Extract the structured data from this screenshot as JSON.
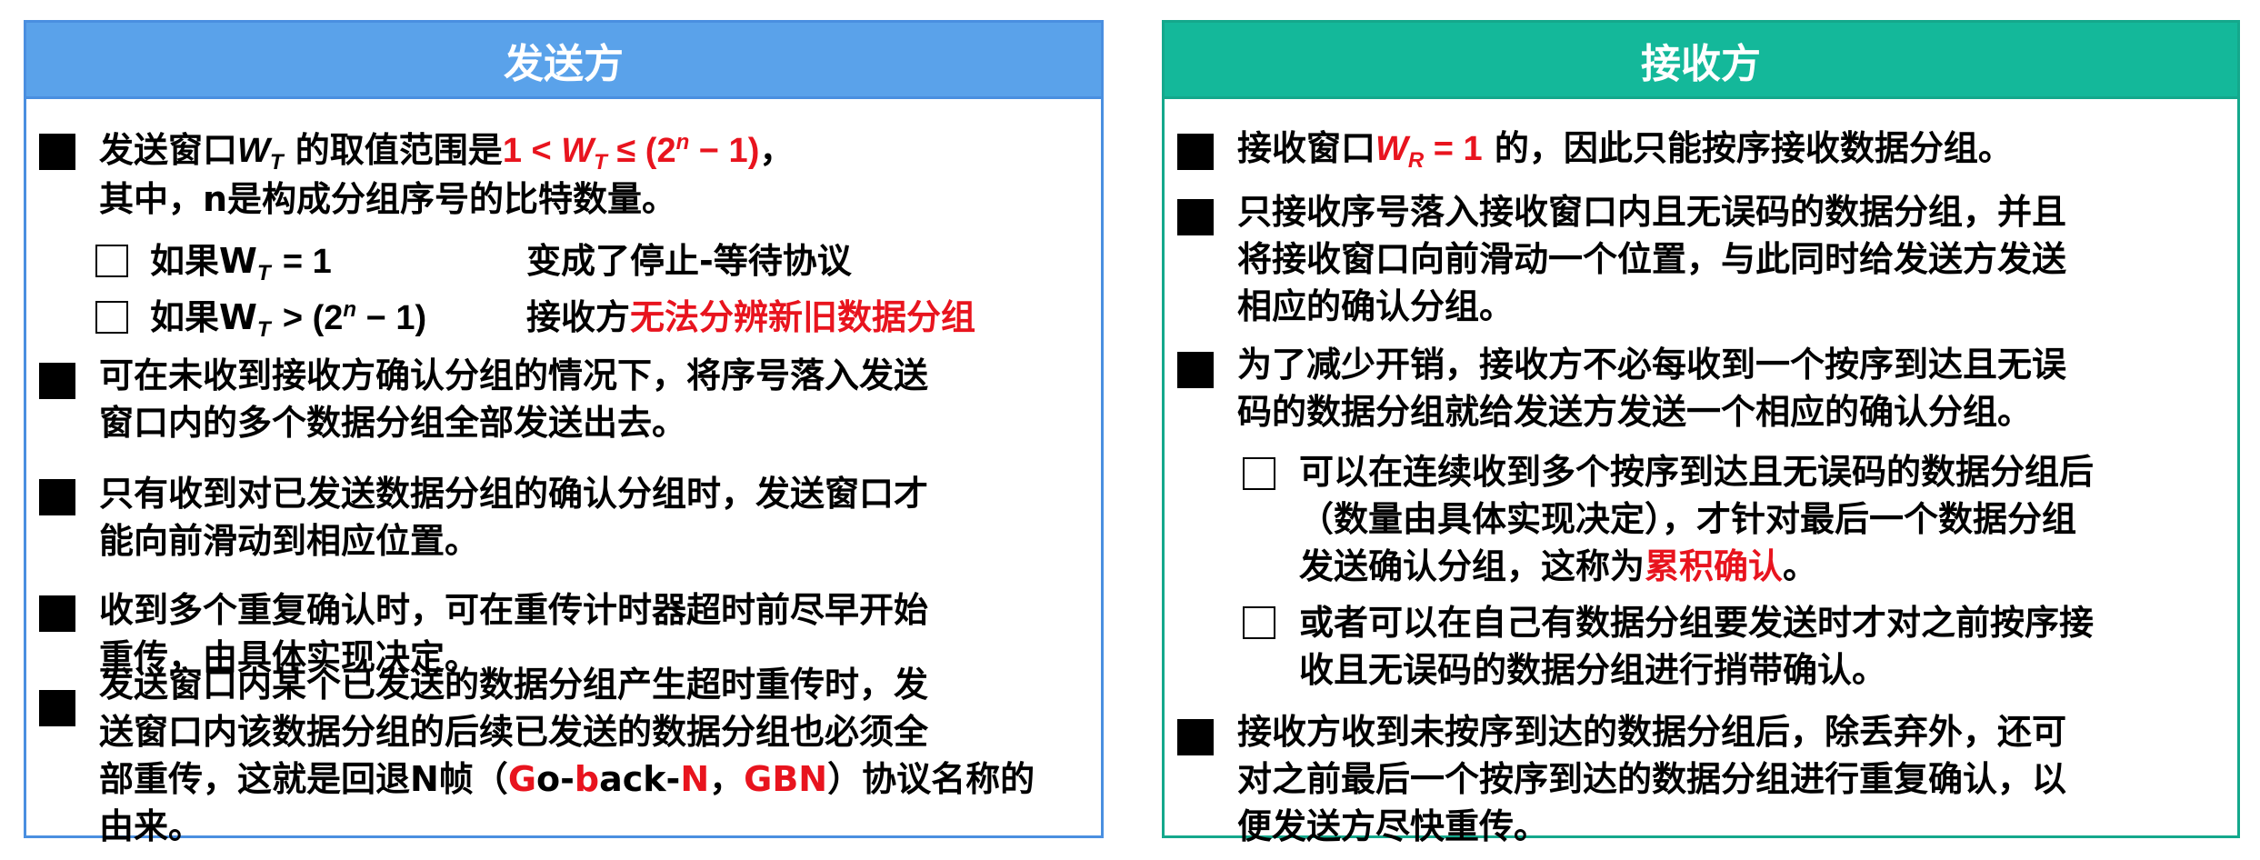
{
  "sender": {
    "title": "发送方",
    "item1_a": "发送窗口",
    "item1_b": "的取值范围是",
    "item1_line2": "其中，n是构成分组序号的比特数量。",
    "sub1_cond": "如果W",
    "sub1_res": "变成了停止-等待协议",
    "sub2_cond": "如果W",
    "sub2_res_a": "接收方",
    "sub2_res_b": "无法分辨新旧数据分组",
    "item2_l1": "可在未收到接收方确认分组的情况下，将序号落入发送",
    "item2_l2": "窗口内的多个数据分组全部发送出去。",
    "item3_l1": "只有收到对已发送数据分组的确认分组时，发送窗口才",
    "item3_l2": "能向前滑动到相应位置。",
    "item4_l1": "收到多个重复确认时，可在重传计时器超时前尽早开始",
    "item4_l2": "重传，由具体实现决定。",
    "item5_l1": "发送窗口内某个已发送的数据分组产生超时重传时，发",
    "item5_l2": "送窗口内该数据分组的后续已发送的数据分组也必须全",
    "item5_l3a": "部重传，这就是回退N帧（",
    "item5_l3b": "G",
    "item5_l3c": "o-",
    "item5_l3d": "b",
    "item5_l3e": "ack-",
    "item5_l3f": "N",
    "item5_l3g": "，",
    "item5_l3h": "GBN",
    "item5_l3i": "）协议名称的",
    "item5_l4": "由来。"
  },
  "receiver": {
    "title": "接收方",
    "item1_a": "接收窗口",
    "item1_b": "的，因此只能按序接收数据分组。",
    "item2_l1": "只接收序号落入接收窗口内且无误码的数据分组，并且",
    "item2_l2": "将接收窗口向前滑动一个位置，与此同时给发送方发送",
    "item2_l3": "相应的确认分组。",
    "item3_l1": "为了减少开销，接收方不必每收到一个按序到达且无误",
    "item3_l2": "码的数据分组就给发送方发送一个相应的确认分组。",
    "sub1_l1": "可以在连续收到多个按序到达且无误码的数据分组后",
    "sub1_l2": "（数量由具体实现决定），才针对最后一个数据分组",
    "sub1_l3a": "发送确认分组，这称为",
    "sub1_l3b": "累积确认",
    "sub1_l3c": "。",
    "sub2_l1": "或者可以在自己有数据分组要发送时才对之前按序接",
    "sub2_l2": "收且无误码的数据分组进行捎带确认。",
    "item4_l1": "接收方收到未按序到达的数据分组后，除丢弃外，还可",
    "item4_l2": "对之前最后一个按序到达的数据分组进行重复确认，以",
    "item4_l3": "便发送方尽快重传。"
  },
  "colors": {
    "sender_header": "#5aa2ea",
    "receiver_header": "#14b89a",
    "highlight": "#e8141e"
  }
}
